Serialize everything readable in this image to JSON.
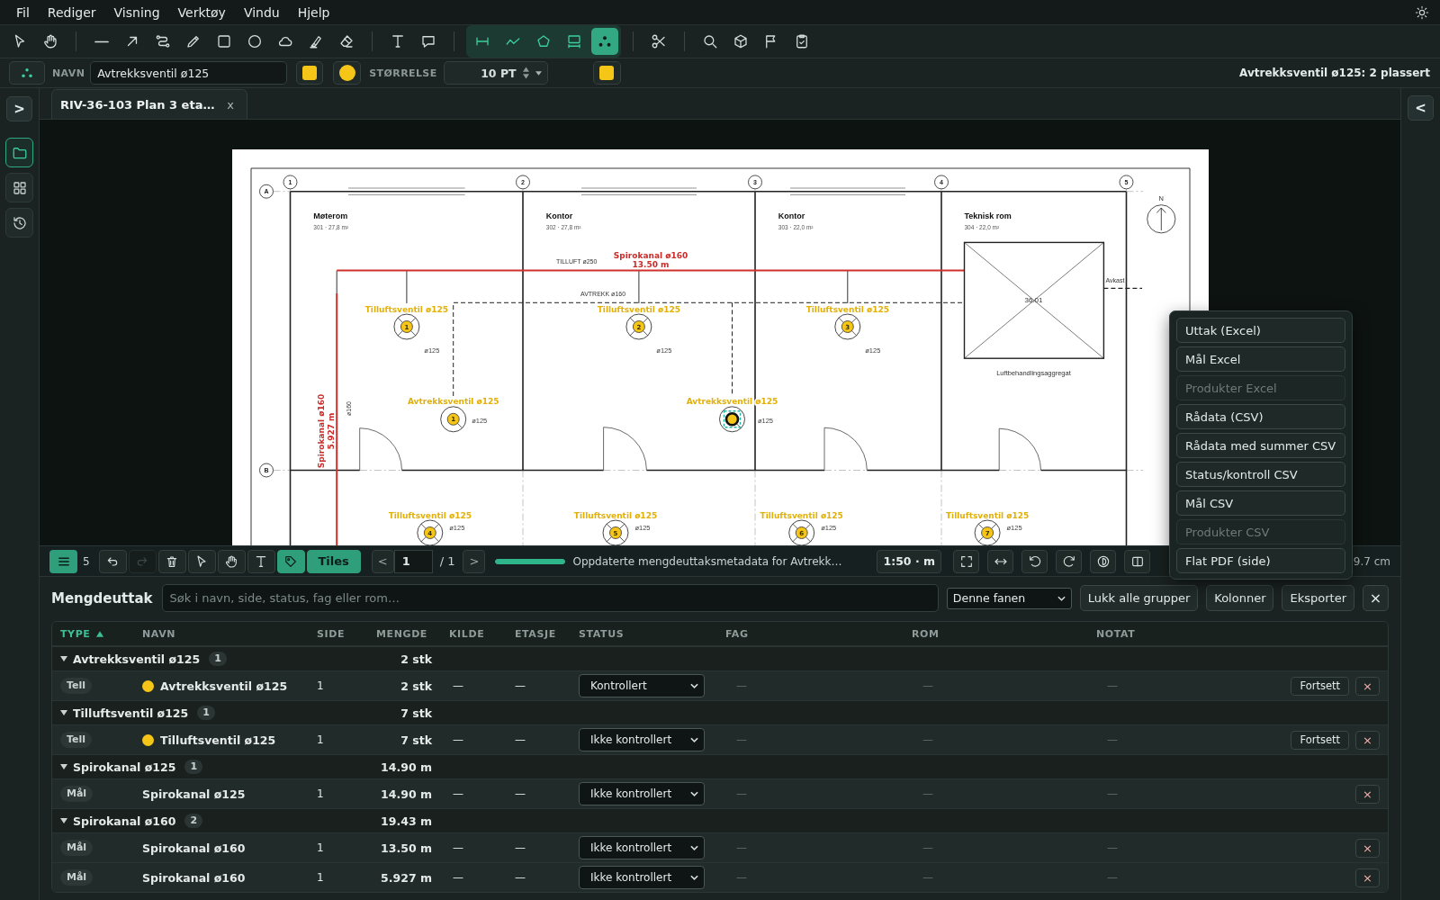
{
  "menu": [
    "Fil",
    "Rediger",
    "Visning",
    "Verktøy",
    "Vindu",
    "Hjelp"
  ],
  "toolbar": {
    "groups": [
      {
        "kind": "plain",
        "tools": [
          {
            "kind": "select",
            "selected": false
          },
          {
            "kind": "hand",
            "selected": false
          }
        ]
      },
      {
        "kind": "plain",
        "tools": [
          {
            "kind": "line",
            "selected": false
          },
          {
            "kind": "arrow",
            "selected": false
          },
          {
            "kind": "path",
            "selected": false
          },
          {
            "kind": "pencil",
            "selected": false
          },
          {
            "kind": "rect",
            "selected": false
          },
          {
            "kind": "ellipse",
            "selected": false
          },
          {
            "kind": "cloud",
            "selected": false
          },
          {
            "kind": "highlighter",
            "selected": false
          },
          {
            "kind": "eraser",
            "selected": false
          }
        ]
      },
      {
        "kind": "plain",
        "tools": [
          {
            "kind": "text",
            "selected": false
          },
          {
            "kind": "comment",
            "selected": false
          }
        ]
      },
      {
        "kind": "measure",
        "tools": [
          {
            "kind": "measure",
            "selected": false
          },
          {
            "kind": "polyline",
            "selected": false
          },
          {
            "kind": "polygon",
            "selected": false
          },
          {
            "kind": "area",
            "selected": false
          },
          {
            "kind": "count",
            "selected": true
          }
        ]
      },
      {
        "kind": "plain",
        "tools": [
          {
            "kind": "scissors",
            "selected": false
          }
        ]
      },
      {
        "kind": "plain",
        "tools": [
          {
            "kind": "search",
            "selected": false
          },
          {
            "kind": "cube",
            "selected": false
          },
          {
            "kind": "flag",
            "selected": false
          },
          {
            "kind": "clipboard",
            "selected": false
          }
        ]
      }
    ]
  },
  "properties": {
    "name_label": "NAVN",
    "name": "Avtrekksventil ø125",
    "swatches": [
      {
        "kind": "square",
        "color": "#f5c518"
      },
      {
        "kind": "circle",
        "color": "#f5c518"
      }
    ],
    "size_label": "STØRRELSE",
    "size": "10 PT",
    "text_swatch": {
      "kind": "square",
      "color": "#f5c518"
    },
    "placement": "Avtrekksventil ø125: 2 plassert"
  },
  "left_sidebar": {
    "toggle": ">",
    "items": [
      {
        "kind": "folder",
        "selected": true
      },
      {
        "kind": "grid",
        "selected": false
      },
      {
        "kind": "history",
        "selected": false
      }
    ]
  },
  "right_sidebar": {
    "toggle": "<"
  },
  "tabs": [
    {
      "title": "RIV-36-103 Plan 3 eta…",
      "close": "x",
      "selected": true
    }
  ],
  "drawing": {
    "grid_columns": [
      "1",
      "2",
      "3",
      "4",
      "5"
    ],
    "grid_rows": [
      "A",
      "B"
    ],
    "rooms": [
      {
        "name": "Møterom",
        "info": "301 · 27,8 m²"
      },
      {
        "name": "Kontor",
        "info": "302 · 27,8 m²"
      },
      {
        "name": "Kontor",
        "info": "303 · 22,0 m²"
      },
      {
        "name": "Teknisk rom",
        "info": "304 · 22,0 m²"
      }
    ],
    "supply_label": "TILLUFT ø250",
    "exhaust_label": "AVTREKK ø160",
    "riser_label": "ø160",
    "measurements": [
      {
        "kind": "horizontal",
        "name": "Spirokanal ø160",
        "value": "13.50 m"
      },
      {
        "kind": "vertical",
        "name": "Spirokanal ø160",
        "value": "5.927 m"
      }
    ],
    "supply_vents": [
      {
        "label": "Tilluftsventil ø125",
        "number": "1",
        "size": "ø125"
      },
      {
        "label": "Tilluftsventil ø125",
        "number": "2",
        "size": "ø125"
      },
      {
        "label": "Tilluftsventil ø125",
        "number": "3",
        "size": "ø125"
      },
      {
        "label": "Tilluftsventil ø125",
        "number": "4",
        "size": "ø125"
      },
      {
        "label": "Tilluftsventil ø125",
        "number": "5",
        "size": "ø125"
      },
      {
        "label": "Tilluftsventil ø125",
        "number": "6",
        "size": "ø125"
      },
      {
        "label": "Tilluftsventil ø125",
        "number": "7",
        "size": "ø125"
      }
    ],
    "exhaust_vents": [
      {
        "label": "Avtrekksventil ø125",
        "number": "1",
        "size": "ø125",
        "selected": false
      },
      {
        "label": "Avtrekksventil ø125",
        "size": "ø125",
        "selected": true
      }
    ],
    "unit": {
      "id": "36.01",
      "name": "Luftbehandlingsaggregat",
      "outlet": "Avkast"
    },
    "north": "N"
  },
  "view_toolbar": {
    "list": {
      "count": "5",
      "selected": true
    },
    "tools": [
      {
        "kind": "undo",
        "on": false,
        "disabled": false
      },
      {
        "kind": "redo",
        "on": false,
        "disabled": true
      },
      {
        "kind": "trash",
        "on": false,
        "disabled": false
      },
      {
        "kind": "select",
        "on": false,
        "disabled": false
      },
      {
        "kind": "hand",
        "on": false,
        "disabled": false
      },
      {
        "kind": "text",
        "on": false,
        "disabled": false
      },
      {
        "kind": "tag",
        "on": true,
        "disabled": false
      }
    ],
    "tiles": {
      "label": "Tiles",
      "on": true
    },
    "page": {
      "prev": "<",
      "current": "1",
      "total": "/ 1",
      "next": ">"
    },
    "progress": {
      "level": 1
    },
    "status": "Oppdaterte mengdeuttaksmetadata for Avtrekk…",
    "scale": "1:50 · m",
    "view_tools": [
      {
        "kind": "fit"
      },
      {
        "kind": "fit-width"
      },
      {
        "kind": "rotate-left"
      },
      {
        "kind": "rotate-right"
      },
      {
        "kind": "contrast"
      },
      {
        "kind": "split"
      }
    ],
    "dimension": "9.7 cm"
  },
  "export_menu": {
    "items": [
      {
        "label": "Uttak (Excel)",
        "disabled": false
      },
      {
        "label": "Mål Excel",
        "disabled": false
      },
      {
        "label": "Produkter Excel",
        "disabled": true
      },
      {
        "label": "Rådata (CSV)",
        "disabled": false
      },
      {
        "label": "Rådata med summer CSV",
        "disabled": false
      },
      {
        "label": "Status/kontroll CSV",
        "disabled": false
      },
      {
        "label": "Mål CSV",
        "disabled": false
      },
      {
        "label": "Produkter CSV",
        "disabled": true
      },
      {
        "label": "Flat PDF (side)",
        "disabled": false
      }
    ]
  },
  "takeoff": {
    "title": "Mengdeuttak",
    "search": {
      "placeholder": "Søk i navn, side, status, fag eller rom…"
    },
    "scope": "Denne fanen",
    "buttons": [
      "Lukk alle grupper",
      "Kolonner",
      "Eksporter"
    ],
    "close": "×",
    "columns": [
      {
        "label": "TYPE",
        "sorted": true
      },
      {
        "label": "NAVN",
        "sorted": false
      },
      {
        "label": "SIDE",
        "sorted": false
      },
      {
        "label": "MENGDE",
        "sorted": false
      },
      {
        "label": "KILDE",
        "sorted": false
      },
      {
        "label": "ETASJE",
        "sorted": false
      },
      {
        "label": "STATUS",
        "sorted": false
      },
      {
        "label": "FAG",
        "sorted": false
      },
      {
        "label": "ROM",
        "sorted": false
      },
      {
        "label": "NOTAT",
        "sorted": false
      }
    ],
    "groups": [
      {
        "name": "Avtrekksventil ø125",
        "count": "1",
        "total": "2 stk",
        "expanded": true,
        "items": [
          {
            "type": "Tell",
            "color": "#f5c518",
            "name": "Avtrekksventil ø125",
            "page": "1",
            "quantity": "2 stk",
            "source": "—",
            "floor": "—",
            "status": "Kontrollert",
            "discipline": "—",
            "room": "—",
            "note": "—",
            "resume": "Fortsett",
            "remove": "×"
          }
        ]
      },
      {
        "name": "Tilluftsventil ø125",
        "count": "1",
        "total": "7 stk",
        "expanded": true,
        "items": [
          {
            "type": "Tell",
            "color": "#f5c518",
            "name": "Tilluftsventil ø125",
            "page": "1",
            "quantity": "7 stk",
            "source": "—",
            "floor": "—",
            "status": "Ikke kontrollert",
            "discipline": "—",
            "room": "—",
            "note": "—",
            "resume": "Fortsett",
            "remove": "×"
          }
        ]
      },
      {
        "name": "Spirokanal ø125",
        "count": "1",
        "total": "14.90 m",
        "expanded": true,
        "items": [
          {
            "type": "Mål",
            "name": "Spirokanal ø125",
            "page": "1",
            "quantity": "14.90 m",
            "source": "—",
            "floor": "—",
            "status": "Ikke kontrollert",
            "discipline": "—",
            "room": "—",
            "note": "—",
            "remove": "×"
          }
        ]
      },
      {
        "name": "Spirokanal ø160",
        "count": "2",
        "total": "19.43 m",
        "expanded": true,
        "items": [
          {
            "type": "Mål",
            "name": "Spirokanal ø160",
            "page": "1",
            "quantity": "13.50 m",
            "source": "—",
            "floor": "—",
            "status": "Ikke kontrollert",
            "discipline": "—",
            "room": "—",
            "note": "—",
            "remove": "×"
          },
          {
            "type": "Mål",
            "name": "Spirokanal ø160",
            "page": "1",
            "quantity": "5.927 m",
            "source": "—",
            "floor": "—",
            "status": "Ikke kontrollert",
            "discipline": "—",
            "room": "—",
            "note": "—",
            "remove": "×"
          }
        ]
      }
    ]
  }
}
